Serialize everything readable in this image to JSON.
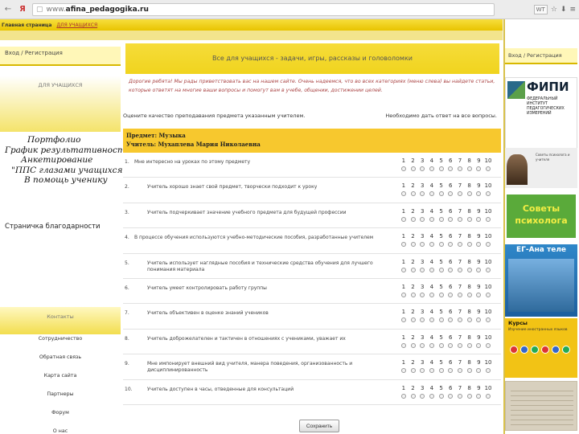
{
  "browser": {
    "nav_back": "←",
    "nav_logo": "Я",
    "url_host": "www.",
    "url_domain": "afina_pedagogika.ru",
    "tool_chip": "WT",
    "tool_star": "☆",
    "tool_menu": "≡",
    "tool_down": "⬇"
  },
  "topbar": {
    "home": "Главная страница",
    "pupils": "ДЛЯ УЧАЩИХСЯ"
  },
  "left_sidebar": {
    "login": "Вход / Регистрация",
    "section_title": "ДЛЯ УЧАЩИХСЯ",
    "menu": [
      "Портфолио",
      "График результативности",
      "Анкетирование",
      "\"ППС глазами учащихся\"",
      "В помощь ученику"
    ],
    "thanks": "Страничка благодарности",
    "contacts_title": "Контакты",
    "contacts": [
      "Сотрудничество",
      "Обратная связь",
      "Карта сайта",
      "Партнеры",
      "Форум",
      "О нас"
    ]
  },
  "main": {
    "banner": "Все для учащихся - задачи, игры, рассказы и головоломки",
    "welcome": "Дорогие ребята! Мы рады приветствовать вас на нашем сайте. Очень надеемся, что во всех категориях (меню слева) вы найдете статьи, которые ответят на многие ваши вопросы и помогут вам в учебе, общении, достижении целей.",
    "survey_left": "Оцените качество преподавания предмета указанным учителем.",
    "survey_right": "Необходимо дать ответ на все вопросы.",
    "subject": "Предмет: Музыка",
    "teacher": "Учитель: Мухаплева Мария Николаевна",
    "scale": [
      "1",
      "2",
      "3",
      "4",
      "5",
      "6",
      "7",
      "8",
      "9",
      "10"
    ],
    "questions": [
      {
        "num": "1.",
        "text": "Мне интересно на уроках по этому предмету"
      },
      {
        "num": "2.",
        "text": "Учитель хорошо знает свой предмет, творчески подходит к уроку"
      },
      {
        "num": "3.",
        "text": "Учитель подчеркивает значение учебного предмета для будущей профессии"
      },
      {
        "num": "4.",
        "text": "В процессе обучения используются учебно-методические пособия, разработанные учителем"
      },
      {
        "num": "5.",
        "text": "Учитель использует наглядные пособия и технические средства обучения для лучшего понимания материала"
      },
      {
        "num": "6.",
        "text": "Учитель умеет контролировать работу группы"
      },
      {
        "num": "7.",
        "text": "Учитель объективен в оценке знаний учеников"
      },
      {
        "num": "8.",
        "text": "Учитель доброжелателен и тактичен в отношениях с учениками, уважает их"
      },
      {
        "num": "9.",
        "text": "Мне импонирует внешний вид учителя, манера поведения, организованность и дисциплинированность"
      },
      {
        "num": "10.",
        "text": "Учитель доступен в часы, отведенные для консультаций"
      }
    ],
    "submit": "Сохранить"
  },
  "right_sidebar": {
    "login": "Вход / Регистрация",
    "fipi_name": "ФИПИ",
    "fipi_sub": "ФЕДЕРАЛЬНЫЙ ИНСТИТУТ ПЕДАГОГИЧЕСКИХ ИЗМЕРЕНИЙ",
    "photo_caption": "Советы психолога и учителя",
    "advice": "Советы психолога",
    "eg_title": "ЕГ-Ана теле",
    "yellow_title": "Курсы",
    "yellow_sub": "Изучение иностранных языков"
  },
  "colors": {
    "accent_yellow": "#f0d41e",
    "subject_bg": "#f7c82e",
    "welcome_text": "#a44"
  }
}
